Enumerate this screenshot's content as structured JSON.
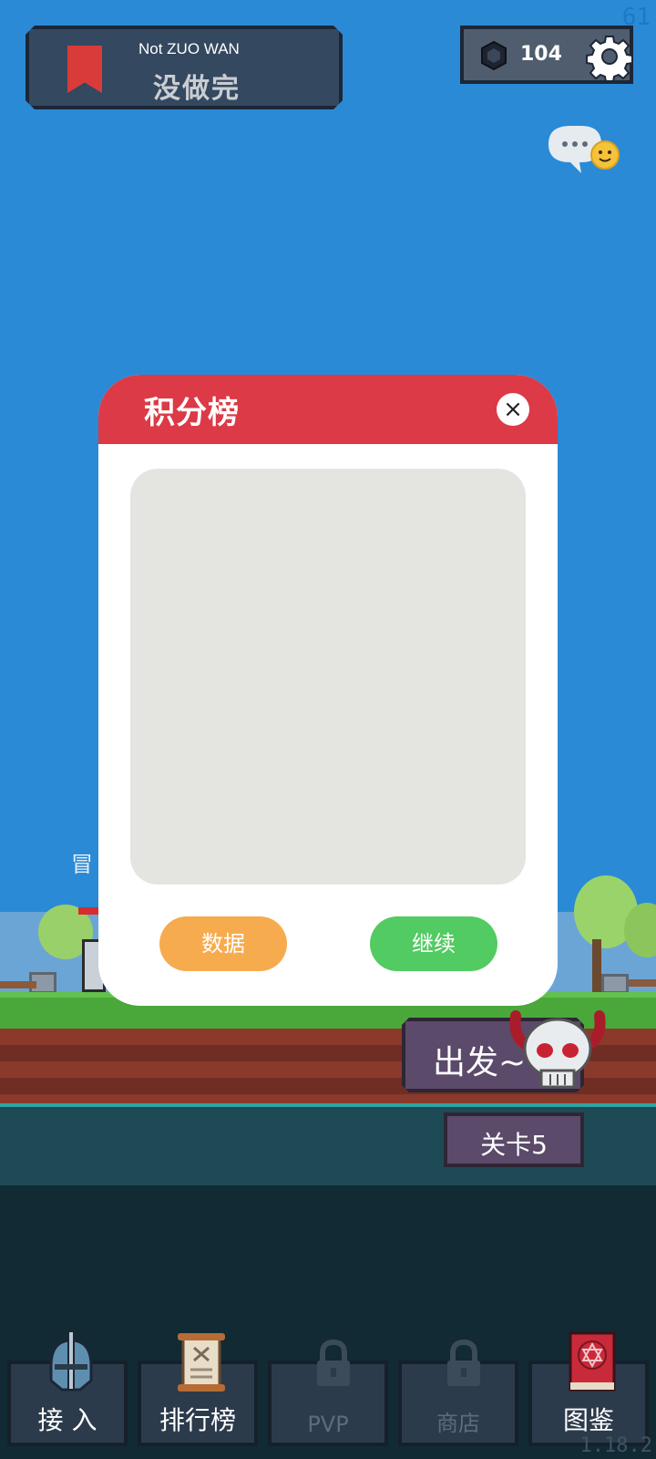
{
  "status": {
    "fps": "61",
    "version": "1.18.2"
  },
  "header": {
    "title_en": "Not ZUO WAN",
    "title_cn": "没做完",
    "currency_value": "104",
    "currency_icon": "gem-icon",
    "settings_icon": "gear-icon"
  },
  "scene": {
    "side_text": "冒",
    "go_label": "出发~",
    "level_label": "关卡5"
  },
  "dialog": {
    "title": "积分榜",
    "close_label": "×",
    "data_button": "数据",
    "continue_button": "继续"
  },
  "nav": {
    "items": [
      {
        "label": "接 入",
        "icon": "helmet-icon",
        "locked": false
      },
      {
        "label": "排行榜",
        "icon": "scroll-icon",
        "locked": false
      },
      {
        "label": "PVP",
        "icon": "lock-icon",
        "locked": true
      },
      {
        "label": "商店",
        "icon": "lock-icon",
        "locked": true
      },
      {
        "label": "图鉴",
        "icon": "spellbook-icon",
        "locked": false
      }
    ]
  },
  "colors": {
    "sky": "#2a8ad6",
    "dialog_header": "#dc3a46",
    "data_button": "#f7ab4f",
    "continue_button": "#52cb62"
  }
}
